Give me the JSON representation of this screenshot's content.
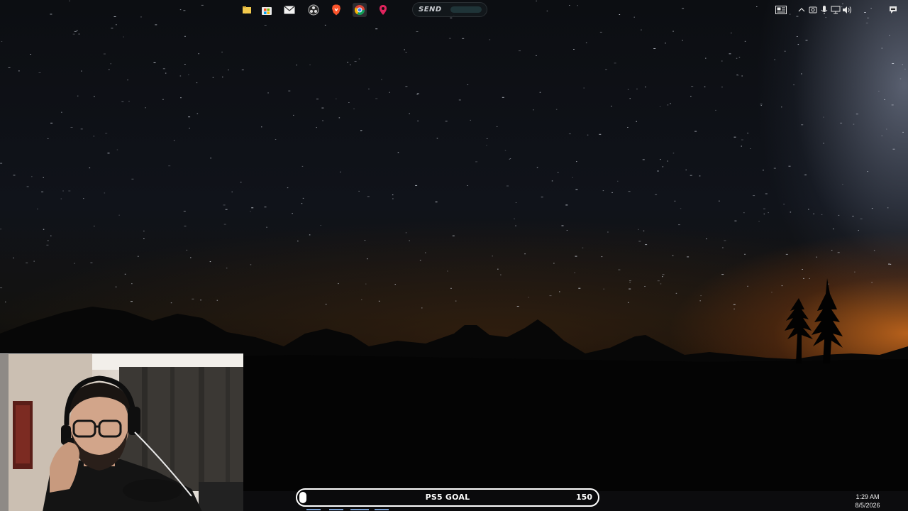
{
  "overlay": {
    "send_label": "SEND"
  },
  "goal": {
    "label": "PS5 GOAL",
    "current": "0",
    "target": "150",
    "progress": 0
  },
  "taskbar": {
    "pinned": [
      {
        "icon": "file-explorer-icon"
      },
      {
        "icon": "microsoft-store-icon"
      },
      {
        "icon": "mail-icon"
      },
      {
        "icon": "obs-icon"
      },
      {
        "icon": "brave-browser-icon"
      },
      {
        "icon": "chrome-icon"
      },
      {
        "icon": "vpn-icon"
      }
    ]
  },
  "tray": {
    "time": "1:29 AM",
    "date": "8/5/2026"
  },
  "colors": {
    "taskbar": "#0c0c0e",
    "goal_border": "#ffffff",
    "horizon_glow": "#d26e1e"
  }
}
